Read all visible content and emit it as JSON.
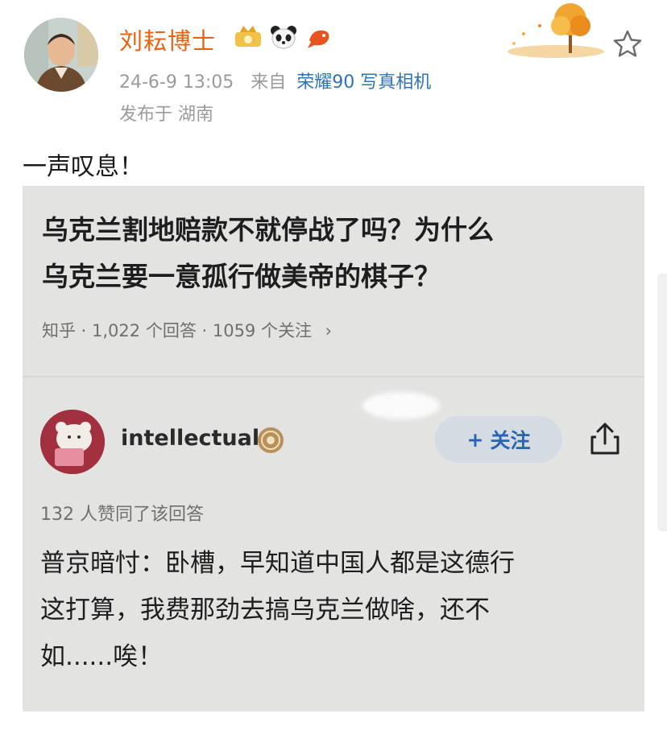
{
  "post": {
    "author": "刘耘博士",
    "time": "24-6-9 13:05",
    "source_prefix": "来自",
    "device": "荣耀90 写真相机",
    "location": "发布于 湖南",
    "text": "一声叹息！"
  },
  "zhihu": {
    "question_line1": "乌克兰割地赔款不就停战了吗？为什么",
    "question_line2": "乌克兰要一意孤行做美帝的棋子？",
    "meta": "知乎 · 1,022 个回答 · 1059 个关注",
    "meta_chevron": "›",
    "answerer": "intellectual",
    "follow_plus": "+",
    "follow_label": "关注",
    "votes": "132 人赞同了该回答",
    "answer_line1": "普京暗忖：卧槽，早知道中国人都是这德行",
    "answer_line2": "这打算，我费那劲去搞乌克兰做啥，还不",
    "answer_line3": "如......唉！"
  },
  "colors": {
    "author": "#e8620f",
    "device_link": "#2c73b8",
    "follow_text": "#2a63b5",
    "follow_bg": "#d4dbe3",
    "screenshot_bg": "#e3e3e1"
  },
  "icons": {
    "star": "star-icon",
    "share": "share-icon",
    "crown_badge": "crown-badge-icon",
    "panda_badge": "panda-badge-icon",
    "fish_badge": "koi-badge-icon",
    "answerer_badge": "medal-badge-icon"
  }
}
